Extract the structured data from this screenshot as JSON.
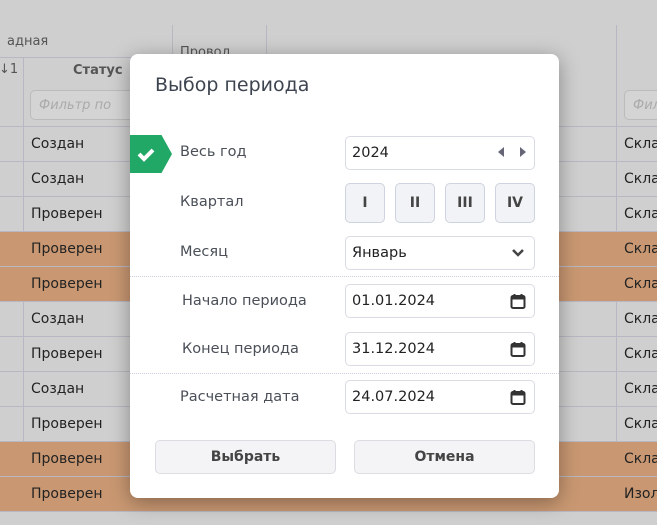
{
  "table": {
    "group_header": "адная",
    "col_provod": "Провод",
    "sort_indicator": "↓1",
    "col_status": "Статус",
    "filter_placeholder": "Фильтр по",
    "filter_placeholder_right": "Фил",
    "rows": [
      {
        "status": "Создан",
        "right": "Скла",
        "highlight": false
      },
      {
        "status": "Создан",
        "right": "Скла",
        "highlight": false
      },
      {
        "status": "Проверен",
        "right": "Скла",
        "highlight": false
      },
      {
        "status": "Проверен",
        "right": "Скла",
        "highlight": true
      },
      {
        "status": "Проверен",
        "right": "Скла",
        "highlight": true
      },
      {
        "status": "Создан",
        "right": "Скла",
        "highlight": false
      },
      {
        "status": "Проверен",
        "right": "Скла",
        "highlight": false
      },
      {
        "status": "Создан",
        "right": "Скла",
        "highlight": false
      },
      {
        "status": "Проверен",
        "right": "Скла",
        "highlight": false
      },
      {
        "status": "Проверен",
        "right": "Скла",
        "highlight": true
      },
      {
        "status": "Проверен",
        "right": "Изол",
        "highlight": true
      }
    ],
    "highlight_color": "#c99872"
  },
  "dialog": {
    "title": "Выбор периода",
    "whole_year_label": "Весь год",
    "year": "2024",
    "quarter_label": "Квартал",
    "quarters": [
      "I",
      "II",
      "III",
      "IV"
    ],
    "month_label": "Месяц",
    "month": "Январь",
    "start_label": "Начало периода",
    "start": "01.01.2024",
    "end_label": "Конец периода",
    "end": "31.12.2024",
    "calc_label": "Расчетная дата",
    "calc": "24.07.2024",
    "select_btn": "Выбрать",
    "cancel_btn": "Отмена",
    "accent": "#22a866"
  }
}
